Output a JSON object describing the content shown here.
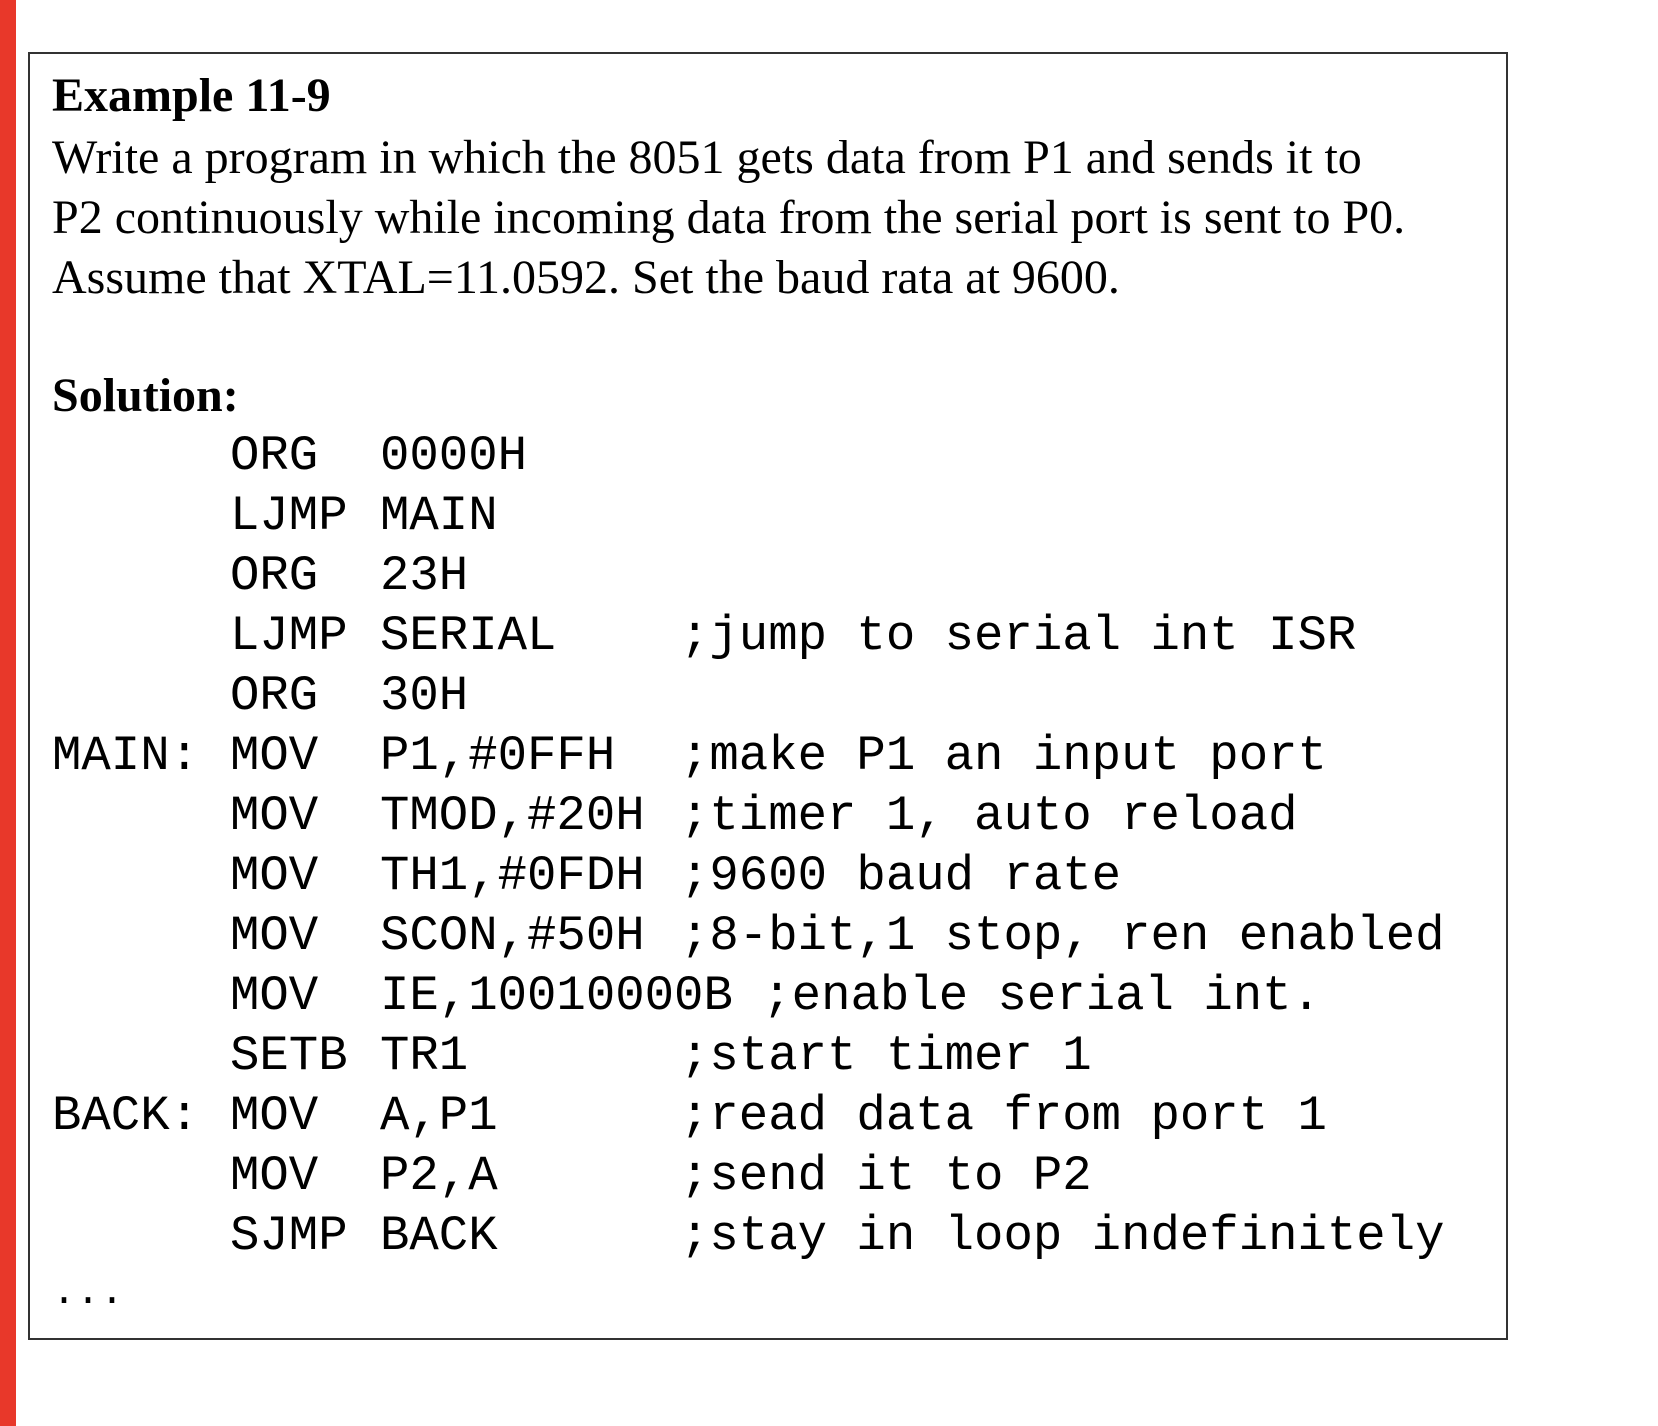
{
  "example": {
    "title": "Example 11-9",
    "problem_lines": [
      "Write a program in which the 8051 gets data from P1 and sends it to",
      "P2 continuously while incoming data from the serial port is sent to P0.",
      "Assume that XTAL=11.0592. Set the baud rata at 9600."
    ],
    "solution_label": "Solution:",
    "code": [
      {
        "label": "",
        "mnemonic": "ORG",
        "operand": "0000H",
        "comment": ""
      },
      {
        "label": "",
        "mnemonic": "LJMP",
        "operand": "MAIN",
        "comment": ""
      },
      {
        "label": "",
        "mnemonic": "ORG",
        "operand": "23H",
        "comment": ""
      },
      {
        "label": "",
        "mnemonic": "LJMP",
        "operand": "SERIAL",
        "comment": ";jump to serial int ISR"
      },
      {
        "label": "",
        "mnemonic": "ORG",
        "operand": "30H",
        "comment": ""
      },
      {
        "label": "MAIN:",
        "mnemonic": "MOV",
        "operand": "P1,#0FFH",
        "comment": ";make P1 an input port"
      },
      {
        "label": "",
        "mnemonic": "MOV",
        "operand": "TMOD,#20H",
        "comment": ";timer 1, auto reload"
      },
      {
        "label": "",
        "mnemonic": "MOV",
        "operand": "TH1,#0FDH",
        "comment": ";9600 baud rate"
      },
      {
        "label": "",
        "mnemonic": "MOV",
        "operand": "SCON,#50H",
        "comment": ";8-bit,1 stop, ren enabled"
      },
      {
        "label": "",
        "mnemonic": "MOV",
        "operand": "IE,10010000B ;enable serial int.",
        "comment": ""
      },
      {
        "label": "",
        "mnemonic": "SETB",
        "operand": "TR1",
        "comment": ";start timer 1"
      },
      {
        "label": "BACK:",
        "mnemonic": "MOV",
        "operand": "A,P1",
        "comment": ";read data from port 1"
      },
      {
        "label": "",
        "mnemonic": "MOV",
        "operand": "P2,A",
        "comment": ";send it to P2"
      },
      {
        "label": "",
        "mnemonic": "SJMP",
        "operand": "BACK",
        "comment": ";stay in loop indefinitely"
      }
    ],
    "ellipsis": "..."
  },
  "colors": {
    "accent_bar": "#e8382a",
    "frame_border": "#333333",
    "text": "#000000"
  }
}
